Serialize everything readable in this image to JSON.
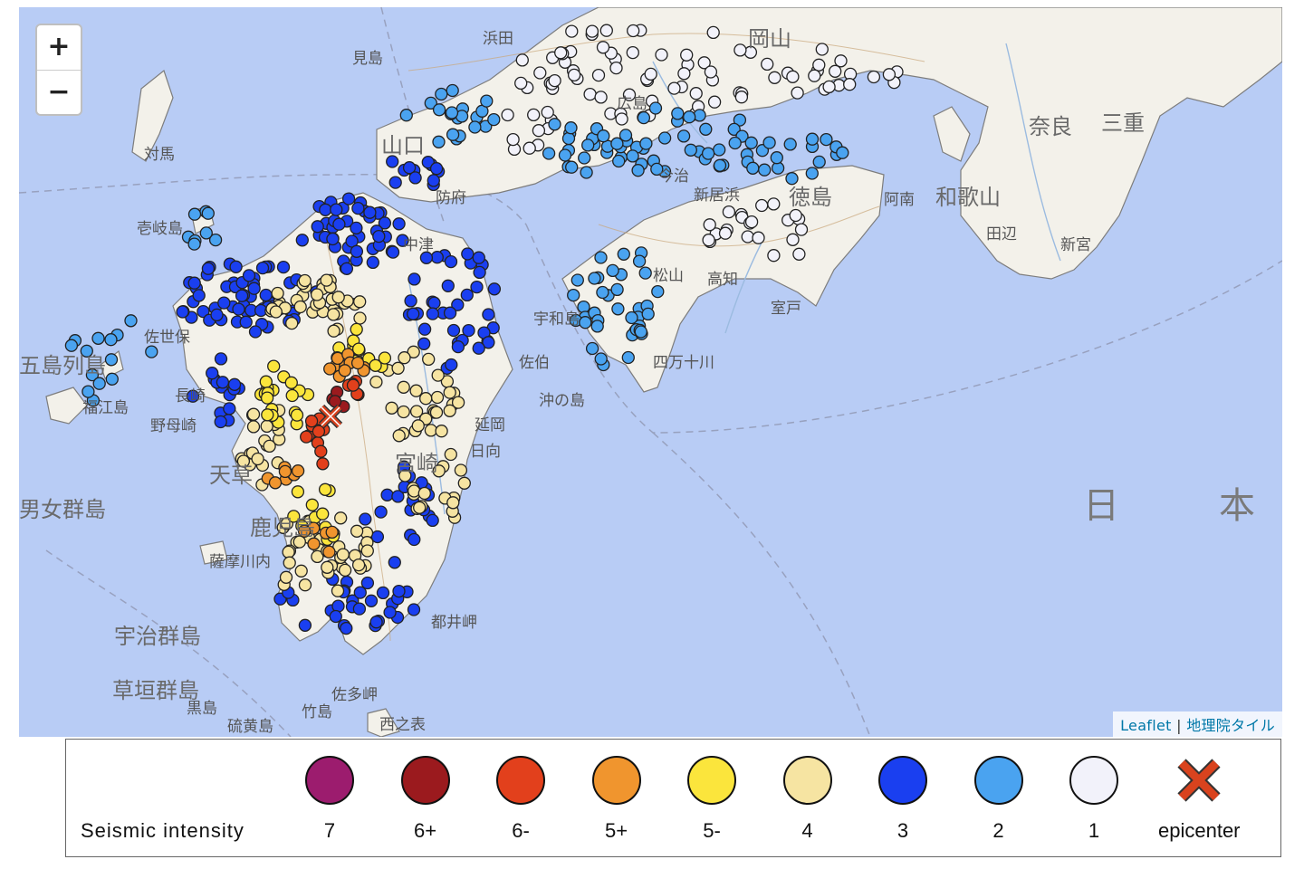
{
  "zoom": {
    "in_label": "+",
    "out_label": "−"
  },
  "attribution": {
    "leaflet": "Leaflet",
    "separator": "|",
    "tiles": "地理院タイル"
  },
  "place_labels": {
    "okayama": "岡山",
    "hamada": "浜田",
    "mishima": "見島",
    "yamaguchi": "山口",
    "hofu": "防府",
    "hiroshima": "広島",
    "imabari": "今治",
    "matsuyama": "松山",
    "niihama": "新居浜",
    "tokushima": "徳島",
    "anan": "阿南",
    "wakayama": "和歌山",
    "tanabe": "田辺",
    "shingu": "新宮",
    "kochi": "高知",
    "muroto": "室戸",
    "uwajima": "宇和島",
    "shimanto": "四万十川",
    "nara": "奈良",
    "mie": "三重",
    "tsushima": "対馬",
    "iki": "壱岐島",
    "goto": "五島列島",
    "fukue": "福江島",
    "sasebo": "佐世保",
    "nagasaki": "長崎",
    "nomozaki": "野母崎",
    "amakusa": "天草",
    "danjo": "男女群島",
    "kagoshima": "鹿児島",
    "satsuma": "薩摩川内",
    "uji": "宇治群島",
    "kusagaki": "草垣群島",
    "miyazaki": "宮崎",
    "nobeoka": "延岡",
    "hyuga": "日向",
    "tanegashima": "西之表",
    "iojima": "硫黄島",
    "kuroshima": "黒島",
    "takeshima": "竹島",
    "nakatsu": "中津",
    "saiki": "佐伯",
    "okinoshima": "沖の島",
    "toshima": "都井岬",
    "satamisaki": "佐多岬",
    "nihon": "日本"
  },
  "stations": {
    "colors": {
      "7": "#9c1c6e",
      "6+": "#9b1a1e",
      "6-": "#e2401c",
      "5+": "#f0952e",
      "5-": "#fbe53c",
      "4": "#f6e4a2",
      "3": "#1a3ff0",
      "2": "#4aa3f0",
      "1": "#f2f2fa"
    },
    "epicenter_color": "#d9431e"
  },
  "legend": {
    "title": "Seismic intensity",
    "items": [
      {
        "label": "7",
        "color": "#9c1c6e"
      },
      {
        "label": "6+",
        "color": "#9b1a1e"
      },
      {
        "label": "6-",
        "color": "#e2401c"
      },
      {
        "label": "5+",
        "color": "#f0952e"
      },
      {
        "label": "5-",
        "color": "#fbe53c"
      },
      {
        "label": "4",
        "color": "#f6e4a2"
      },
      {
        "label": "3",
        "color": "#1a3ff0"
      },
      {
        "label": "2",
        "color": "#4aa3f0"
      },
      {
        "label": "1",
        "color": "#f2f2fa"
      }
    ],
    "epicenter_label": "epicenter"
  }
}
